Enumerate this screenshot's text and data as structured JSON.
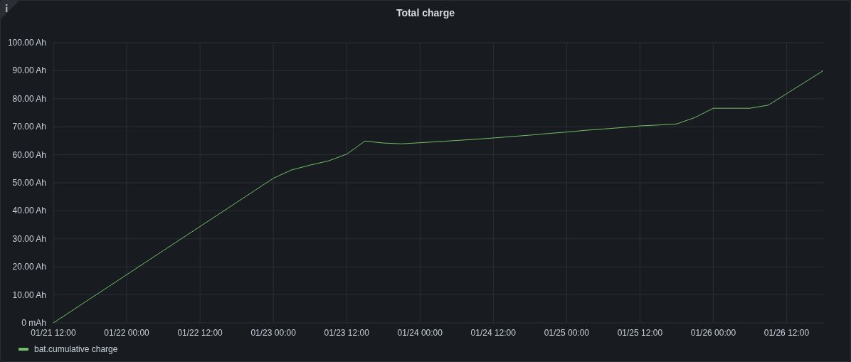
{
  "panel": {
    "title": "Total charge",
    "chart_data": {
      "type": "line",
      "categories": [
        "01/21 12:00",
        null,
        null,
        null,
        "01/22 00:00",
        null,
        null,
        null,
        "01/22 12:00",
        null,
        null,
        null,
        "01/23 00:00",
        null,
        null,
        null,
        "01/23 12:00",
        null,
        null,
        null,
        "01/24 00:00",
        null,
        null,
        null,
        "01/24 12:00",
        null,
        null,
        null,
        "01/25 00:00",
        null,
        null,
        null,
        "01/25 12:00",
        null,
        null,
        null,
        "01/26 00:00",
        null,
        null,
        null,
        "01/26 12:00",
        null,
        null
      ],
      "series": [
        {
          "name": "bat.cumulative charge",
          "color": "#73bf69",
          "values": [
            0,
            4.3,
            8.6,
            12.9,
            17.2,
            21.5,
            25.8,
            30.1,
            34.4,
            38.7,
            43.0,
            47.3,
            51.6,
            54.6,
            56.3,
            57.8,
            60.2,
            64.9,
            64.2,
            63.9,
            64.3,
            64.7,
            65.1,
            65.5,
            66.0,
            66.5,
            67.0,
            67.6,
            68.1,
            68.7,
            69.2,
            69.7,
            70.3,
            70.6,
            71.0,
            73.3,
            76.6,
            76.6,
            76.6,
            77.7,
            81.8,
            85.9,
            90.0
          ]
        }
      ],
      "ylim": [
        0,
        100
      ],
      "grid": true,
      "yticks": [
        {
          "value": 0,
          "label": "0 mAh"
        },
        {
          "value": 10,
          "label": "10.00 Ah"
        },
        {
          "value": 20,
          "label": "20.00 Ah"
        },
        {
          "value": 30,
          "label": "30.00 Ah"
        },
        {
          "value": 40,
          "label": "40.00 Ah"
        },
        {
          "value": 50,
          "label": "50.00 Ah"
        },
        {
          "value": 60,
          "label": "60.00 Ah"
        },
        {
          "value": 70,
          "label": "70.00 Ah"
        },
        {
          "value": 80,
          "label": "80.00 Ah"
        },
        {
          "value": 90,
          "label": "90.00 Ah"
        },
        {
          "value": 100,
          "label": "100.00 Ah"
        }
      ]
    }
  }
}
